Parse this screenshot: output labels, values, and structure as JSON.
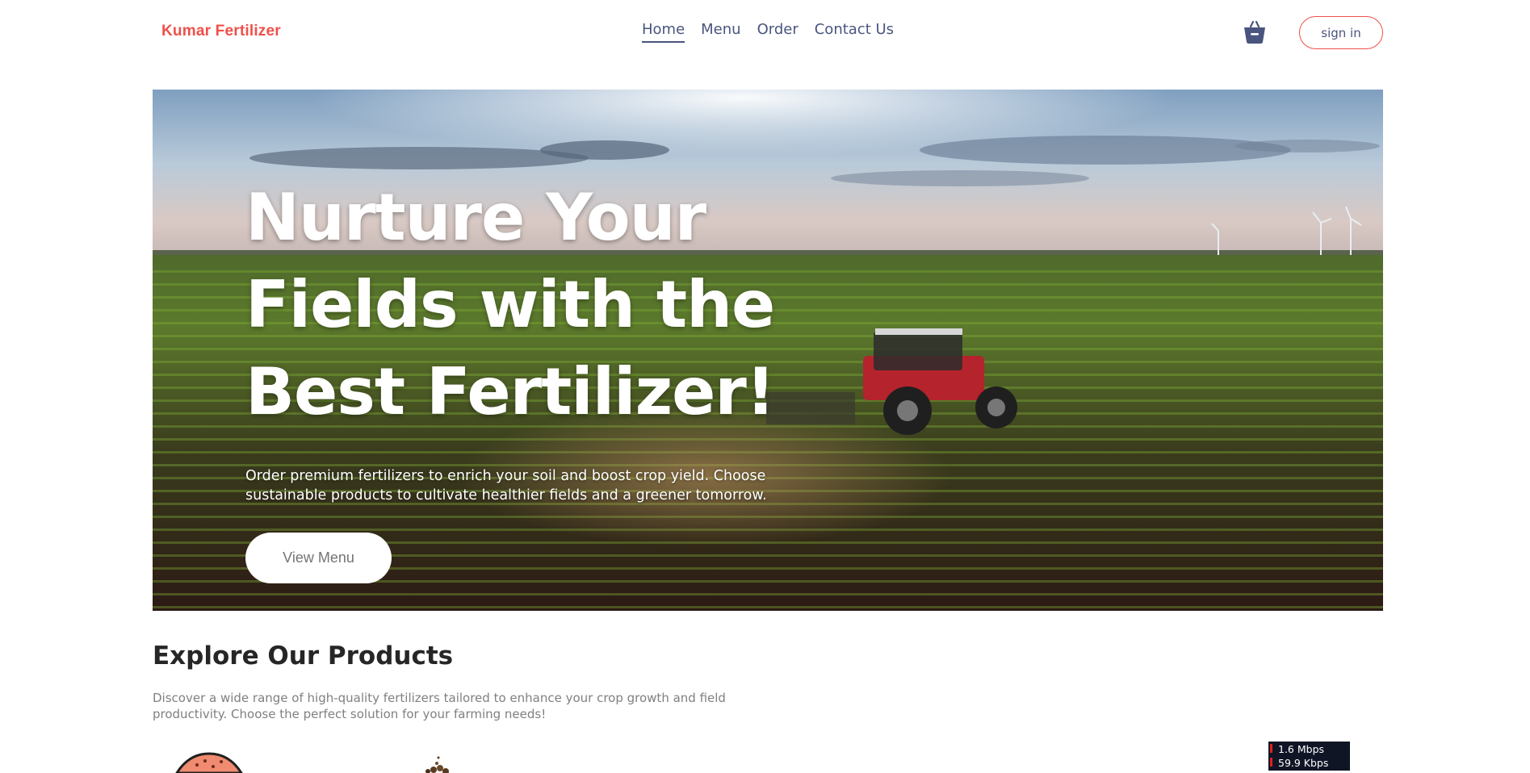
{
  "header": {
    "logo": "Kumar Fertilizer",
    "nav": [
      {
        "label": "Home",
        "active": true
      },
      {
        "label": "Menu",
        "active": false
      },
      {
        "label": "Order",
        "active": false
      },
      {
        "label": "Contact Us",
        "active": false
      }
    ],
    "basket_icon": "basket-icon",
    "signin_label": "sign in"
  },
  "hero": {
    "title": "Nurture Your Fields with the Best Fertilizer!",
    "description": "Order premium fertilizers to enrich your soil and boost crop yield. Choose sustainable products to cultivate healthier fields and a greener tomorrow.",
    "button_label": "View Menu"
  },
  "explore": {
    "title": "Explore Our Products",
    "description": "Discover a wide range of high-quality fertilizers tailored to enhance your crop growth and field productivity. Choose the perfect solution for your farming needs!"
  },
  "network_monitor": {
    "download": "1.6 Mbps",
    "upload": "59.9 Kbps"
  },
  "colors": {
    "brand": "#f0504a",
    "nav_text": "#49557e",
    "heading": "#262626",
    "muted": "#808080"
  }
}
